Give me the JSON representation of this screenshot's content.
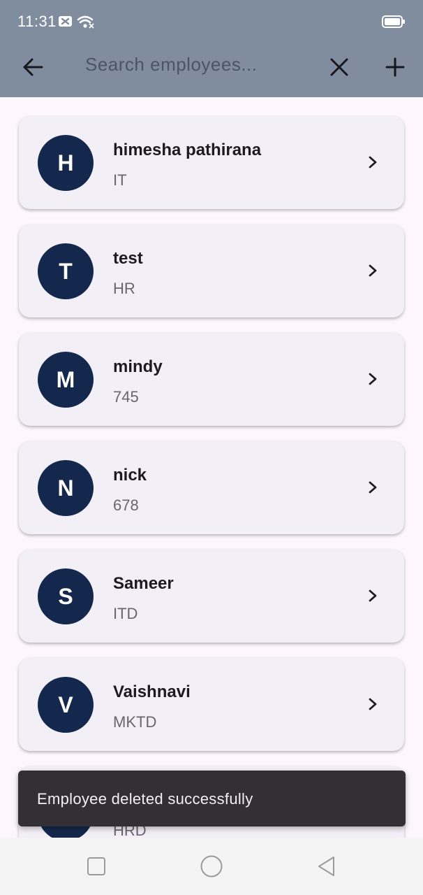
{
  "status_bar": {
    "time": "11:31"
  },
  "header": {
    "search_placeholder": "Search employees...",
    "back_icon": "arrow-left-icon",
    "clear_icon": "close-icon",
    "add_icon": "plus-icon"
  },
  "employees": [
    {
      "initial": "H",
      "name": "himesha pathirana",
      "department": "IT"
    },
    {
      "initial": "T",
      "name": "test",
      "department": "HR"
    },
    {
      "initial": "M",
      "name": "mindy",
      "department": "745"
    },
    {
      "initial": "N",
      "name": "nick",
      "department": "678"
    },
    {
      "initial": "S",
      "name": "Sameer",
      "department": "ITD"
    },
    {
      "initial": "V",
      "name": "Vaishnavi",
      "department": "MKTD"
    },
    {
      "initial": "",
      "name": "",
      "department": "HRD"
    }
  ],
  "snackbar": {
    "message": "Employee deleted successfully"
  },
  "colors": {
    "appbar": "#808d9f",
    "avatar": "#14284d",
    "card": "#f3eff6",
    "snackbar": "#322f35"
  }
}
